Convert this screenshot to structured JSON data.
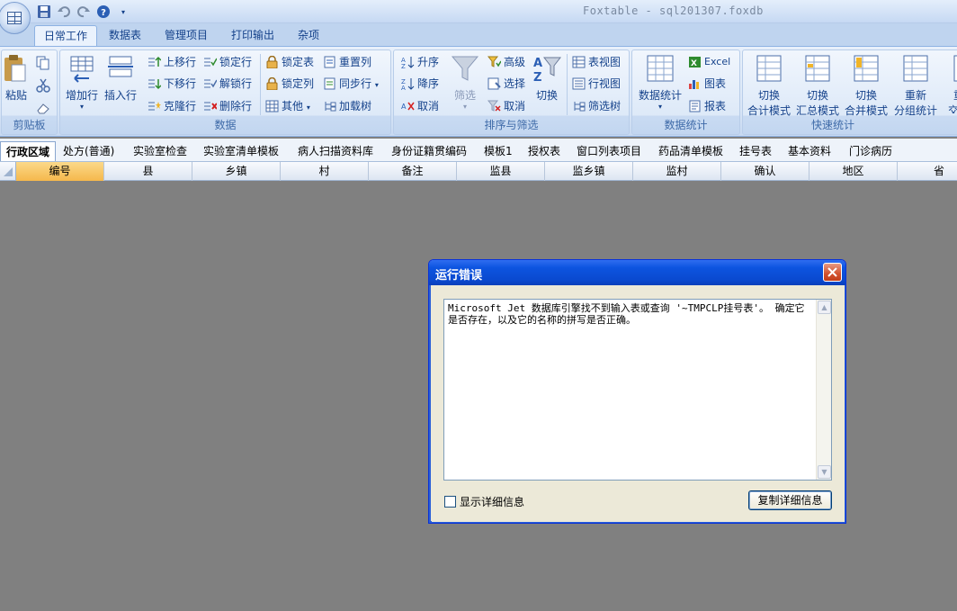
{
  "app": {
    "title": "Foxtable - sql201307.foxdb"
  },
  "ribbon_tabs": [
    "日常工作",
    "数据表",
    "管理项目",
    "打印输出",
    "杂项"
  ],
  "ribbon": {
    "clipboard": {
      "label": "剪贴板",
      "paste": "粘贴"
    },
    "data": {
      "label": "数据",
      "add_row": "增加行",
      "insert_row": "插入行",
      "move_up": "上移行",
      "move_down": "下移行",
      "clone_row": "克隆行",
      "lock_row": "锁定行",
      "unlock_row": "解锁行",
      "delete_row": "删除行",
      "lock_table": "锁定表",
      "lock_col": "锁定列",
      "other": "其他",
      "reset_col": "重置列",
      "sync_row": "同步行",
      "load_tree": "加载树"
    },
    "sort": {
      "label": "排序与筛选",
      "asc": "升序",
      "desc": "降序",
      "cancel": "取消",
      "filter": "筛选",
      "advanced": "高级",
      "select": "选择",
      "cancel2": "取消",
      "toggle": "切换"
    },
    "views": {
      "table_view": "表视图",
      "row_view": "行视图",
      "filter_tree": "筛选树"
    },
    "stats": {
      "label": "数据统计",
      "data_stats": "数据统计",
      "excel": "Excel",
      "chart": "图表",
      "report": "报表"
    },
    "quick": {
      "label": "快速统计",
      "b1a": "切换",
      "b1b": "合计模式",
      "b2a": "切换",
      "b2b": "汇总模式",
      "b3a": "切换",
      "b3b": "合并模式",
      "b4a": "重新",
      "b4b": "分组统计",
      "b5a": "重",
      "b5b": "交叉"
    }
  },
  "sheet_tabs": [
    "行政区域",
    "处方(普通)",
    "实验室检查",
    "实验室清单模板",
    "病人扫描资料库",
    "身份证籍贯编码",
    "模板1",
    "授权表",
    "窗口列表项目",
    "药品清单模板",
    "挂号表",
    "基本资料",
    "门诊病历"
  ],
  "columns": [
    "编号",
    "县",
    "乡镇",
    "村",
    "备注",
    "监县",
    "监乡镇",
    "监村",
    "确认",
    "地区",
    "省"
  ],
  "dialog": {
    "title": "运行错误",
    "message": "Microsoft Jet 数据库引擎找不到输入表或查询 '~TMPCLP挂号表'。 确定它是否存在，以及它的名称的拼写是否正确。",
    "checkbox_label": "显示详细信息",
    "copy_button": "复制详细信息"
  }
}
